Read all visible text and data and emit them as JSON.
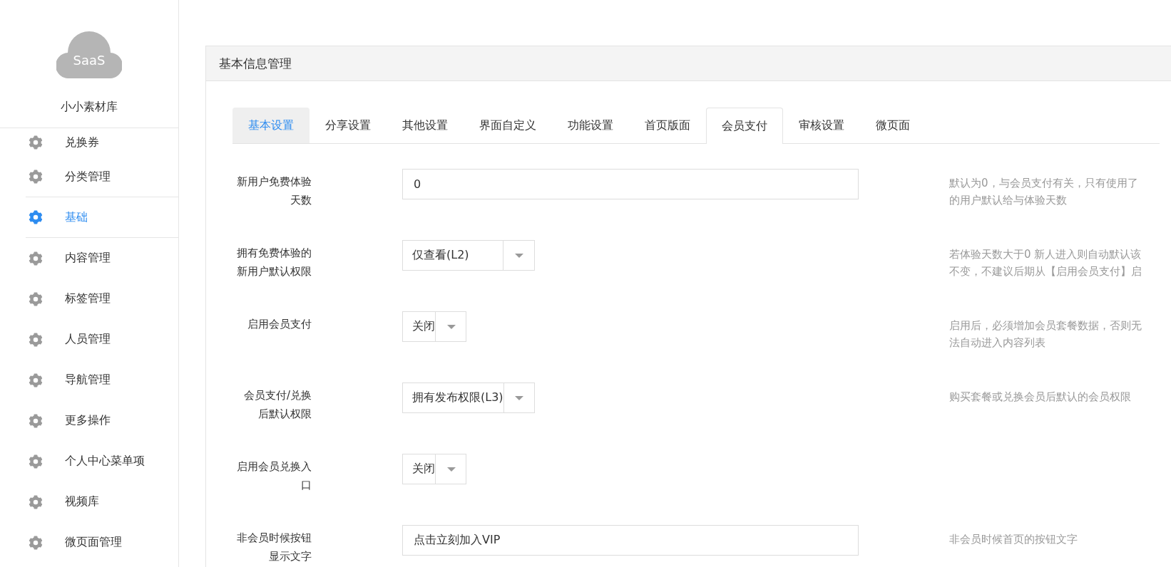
{
  "sidebar": {
    "logo": {
      "text": "SaaS"
    },
    "brand": "小小素材库",
    "items": [
      {
        "label": "兑换券",
        "selected": false
      },
      {
        "label": "分类管理",
        "selected": false
      },
      {
        "label": "基础",
        "selected": true
      },
      {
        "label": "内容管理",
        "selected": false
      },
      {
        "label": "标签管理",
        "selected": false
      },
      {
        "label": "人员管理",
        "selected": false
      },
      {
        "label": "导航管理",
        "selected": false
      },
      {
        "label": "更多操作",
        "selected": false
      },
      {
        "label": "个人中心菜单项",
        "selected": false
      },
      {
        "label": "视频库",
        "selected": false
      },
      {
        "label": "微页面管理",
        "selected": false
      }
    ]
  },
  "panel": {
    "title": "基本信息管理",
    "tabs": [
      {
        "label": "基本设置",
        "selected": false,
        "highlighted": true
      },
      {
        "label": "分享设置",
        "selected": false,
        "highlighted": false
      },
      {
        "label": "其他设置",
        "selected": false,
        "highlighted": false
      },
      {
        "label": "界面自定义",
        "selected": false,
        "highlighted": false
      },
      {
        "label": "功能设置",
        "selected": false,
        "highlighted": false
      },
      {
        "label": "首页版面",
        "selected": false,
        "highlighted": false
      },
      {
        "label": "会员支付",
        "selected": true,
        "highlighted": false
      },
      {
        "label": "审核设置",
        "selected": false,
        "highlighted": false
      },
      {
        "label": "微页面",
        "selected": false,
        "highlighted": false
      }
    ],
    "fields": [
      {
        "kind": "text",
        "label_lines": [
          "新用户免费体验",
          "天数"
        ],
        "value": "0",
        "hint_lines": [
          "默认为0，与会员支付有关，只有使用了",
          "的用户默认给与体验天数"
        ]
      },
      {
        "kind": "select",
        "label_lines": [
          "拥有免费体验的",
          "新用户默认权限"
        ],
        "value": "仅查看(L2)",
        "hint_lines": [
          "若体验天数大于0 新人进入则自动默认该",
          "不变，不建议后期从【启用会员支付】启"
        ]
      },
      {
        "kind": "switch",
        "label_lines": [
          "启用会员支付"
        ],
        "value": "关闭",
        "hint_lines": [
          "启用后，必须增加会员套餐数据，否则无",
          "法自动进入内容列表"
        ]
      },
      {
        "kind": "select",
        "label_lines": [
          "会员支付/兑换",
          "后默认权限"
        ],
        "value": "拥有发布权限(L3)",
        "hint_lines": [
          "购买套餐或兑换会员后默认的会员权限"
        ]
      },
      {
        "kind": "switch",
        "label_lines": [
          "启用会员兑换入",
          "口"
        ],
        "value": "关闭"
      },
      {
        "kind": "text",
        "label_lines": [
          "非会员时候按钮",
          "显示文字"
        ],
        "value": "点击立刻加入VIP",
        "hint_lines": [
          "非会员时候首页的按钮文字"
        ]
      }
    ]
  }
}
